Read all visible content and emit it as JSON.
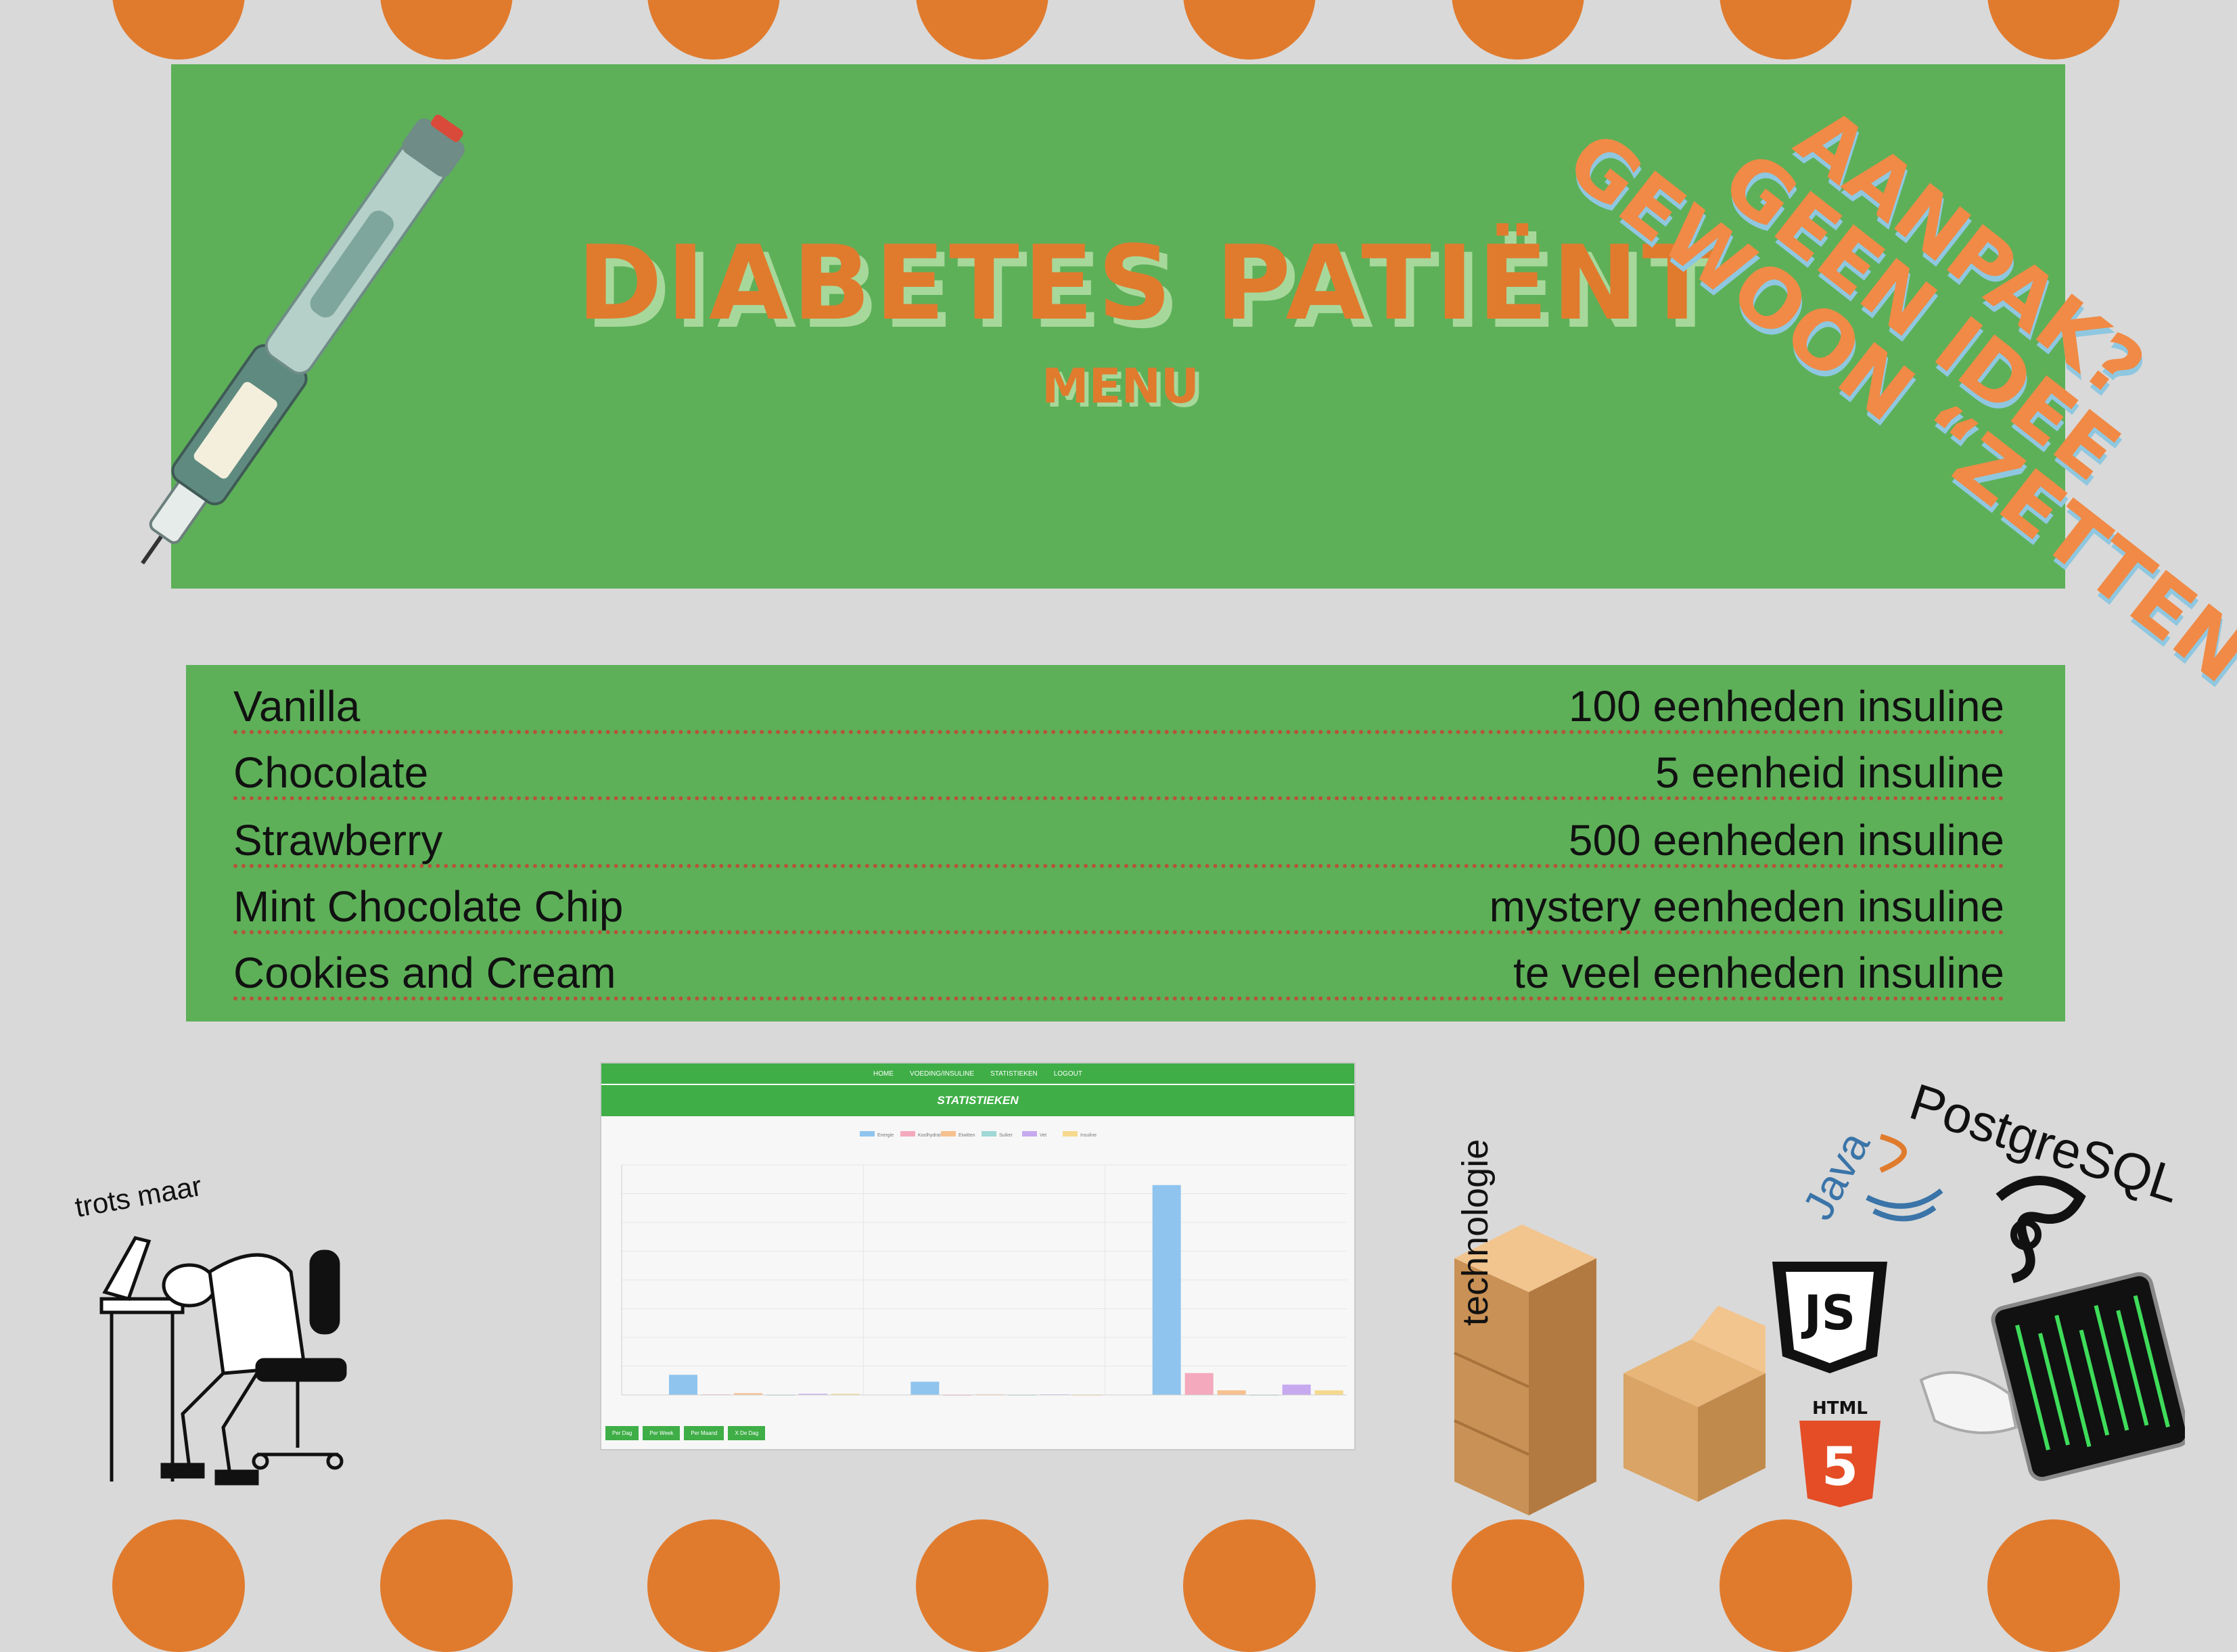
{
  "header": {
    "title": "DIABETES PATIËNT",
    "subtitle": "MENU",
    "diagonal_lines": [
      "AANPAK?",
      "GEEN IDEE",
      "GEWOON “ZETTEN”"
    ]
  },
  "menu": {
    "items": [
      {
        "name": "Vanilla",
        "value": "100 eenheden insuline"
      },
      {
        "name": "Chocolate",
        "value": "5 eenheid insuline"
      },
      {
        "name": "Strawberry",
        "value": "500 eenheden insuline"
      },
      {
        "name": "Mint Chocolate Chip",
        "value": "mystery eenheden insuline"
      },
      {
        "name": "Cookies and Cream",
        "value": "te veel eenheden insuline"
      }
    ]
  },
  "screenshot": {
    "nav": [
      "HOME",
      "VOEDING/INSULINE",
      "STATISTIEKEN",
      "LOGOUT"
    ],
    "heading": "STATISTIEKEN",
    "buttons": [
      "Per Dag",
      "Per Week",
      "Per Maand",
      "X De Dag"
    ],
    "chart_data": {
      "type": "bar",
      "categories": [
        "",
        "",
        ""
      ],
      "series": [
        {
          "name": "Energie",
          "values": [
            350,
            230,
            3650
          ]
        },
        {
          "name": "Koolhydraten",
          "values": [
            10,
            0,
            380
          ]
        },
        {
          "name": "Eiwitten",
          "values": [
            30,
            10,
            80
          ]
        },
        {
          "name": "Suiker",
          "values": [
            0,
            0,
            0
          ]
        },
        {
          "name": "Vet",
          "values": [
            20,
            10,
            180
          ]
        },
        {
          "name": "Insuline",
          "values": [
            20,
            0,
            80
          ]
        }
      ],
      "ylim": [
        0,
        4000
      ],
      "legend": "top"
    }
  },
  "labels": {
    "trots": "trots maar",
    "technologie": "technologie",
    "postgres": "PostgreSQL",
    "java": "Java",
    "html5": "HTML"
  },
  "colors": {
    "orange": "#e07b2e",
    "green": "#5db058",
    "background": "#d9d9d9"
  }
}
